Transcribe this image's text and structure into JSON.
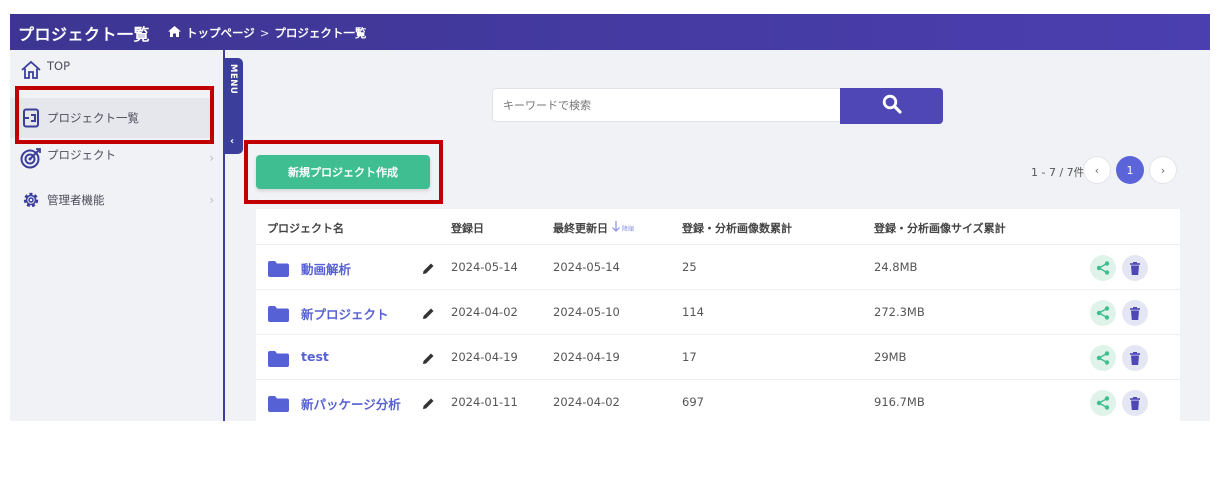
{
  "header": {
    "title": "プロジェクト一覧",
    "breadcrumb": [
      "トップページ",
      "プロジェクト一覧"
    ],
    "separator": ">"
  },
  "sidebar": {
    "items": [
      {
        "label": "TOP",
        "icon": "home-icon"
      },
      {
        "label": "プロジェクト一覧",
        "icon": "project-list-icon",
        "active": true
      },
      {
        "label": "プロジェクト",
        "icon": "target-icon"
      },
      {
        "label": "管理者機能",
        "icon": "gear-icon"
      }
    ],
    "chevron": "›"
  },
  "menu_tab": {
    "label": "MENU",
    "arrow": "‹"
  },
  "search": {
    "placeholder": "キーワードで検索",
    "value": ""
  },
  "new_project_button": "新規プロジェクト作成",
  "pagination": {
    "info": "1 - 7 / 7件",
    "prev": "‹",
    "current": "1",
    "next": "›"
  },
  "table": {
    "headers": {
      "name": "プロジェクト名",
      "registered": "登録日",
      "updated": "最終更新日",
      "sort_hint": "降順",
      "image_count": "登録・分析画像数累計",
      "image_size": "登録・分析画像サイズ累計"
    },
    "rows": [
      {
        "name": "動画解析",
        "registered": "2024-05-14",
        "updated": "2024-05-14",
        "count": "25",
        "size": "24.8MB"
      },
      {
        "name": "新プロジェクト",
        "registered": "2024-04-02",
        "updated": "2024-05-10",
        "count": "114",
        "size": "272.3MB"
      },
      {
        "name": "test",
        "registered": "2024-04-19",
        "updated": "2024-04-19",
        "count": "17",
        "size": "29MB"
      },
      {
        "name": "新パッケージ分析",
        "registered": "2024-01-11",
        "updated": "2024-04-02",
        "count": "697",
        "size": "916.7MB"
      }
    ]
  },
  "colors": {
    "header": "#4b3fb0",
    "accent": "#5761d6",
    "new_button": "#3fbe92",
    "highlight_box": "#c00000",
    "share": "#3fbe92",
    "trash": "#4f47b6"
  }
}
